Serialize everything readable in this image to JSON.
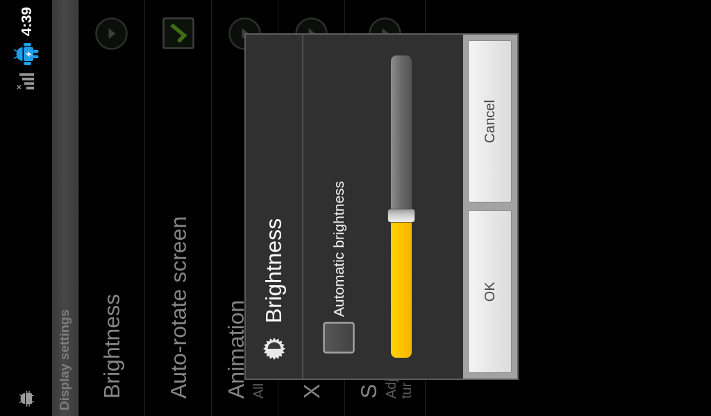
{
  "status_bar": {
    "time": "4:39"
  },
  "title_bar": {
    "title": "Display settings"
  },
  "settings_list": [
    {
      "kind": "link",
      "title": "Brightness"
    },
    {
      "kind": "checkbox",
      "title": "Auto-rotate screen",
      "checked": true
    },
    {
      "kind": "link",
      "title": "Animation",
      "summary_lines": [
        "All"
      ]
    },
    {
      "kind": "link",
      "title": "X"
    },
    {
      "kind": "link",
      "title": "S",
      "summary_lines": [
        "Adj",
        "tur"
      ]
    }
  ],
  "dialog": {
    "title": "Brightness",
    "auto_brightness": {
      "label": "Automatic brightness",
      "checked": false
    },
    "slider": {
      "level": 0.47
    },
    "buttons": [
      "OK",
      "Cancel"
    ]
  }
}
